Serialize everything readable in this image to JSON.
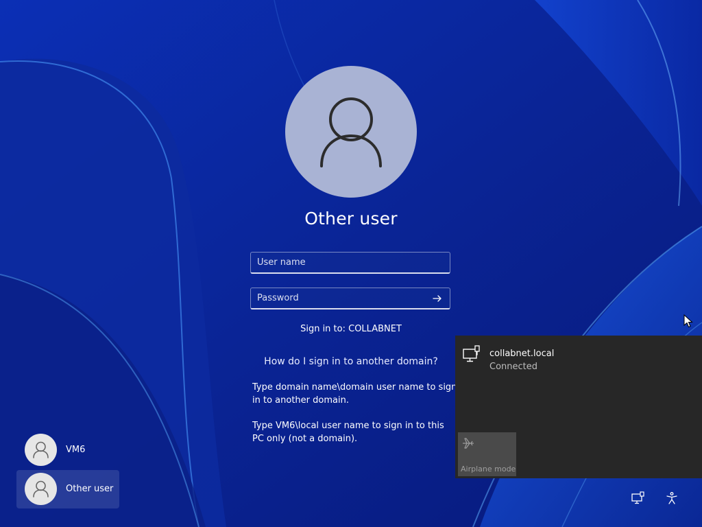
{
  "login": {
    "user_title": "Other user",
    "username_placeholder": "User name",
    "password_placeholder": "Password",
    "sign_in_to": "Sign in to: COLLABNET",
    "help_link": "How do I sign in to another domain?",
    "help_text_1": "Type domain name\\domain user name to sign in to another domain.",
    "help_text_2": "Type VM6\\local user name to sign in to this PC only (not a domain)."
  },
  "users": [
    {
      "name": "VM6",
      "selected": false
    },
    {
      "name": "Other user",
      "selected": true
    }
  ],
  "network_flyout": {
    "network_name": "collabnet.local",
    "status": "Connected",
    "airplane_label": "Airplane mode",
    "airplane_on": false
  },
  "tray": {
    "icons": [
      "network-icon",
      "accessibility-icon"
    ]
  },
  "colors": {
    "background": "#0a2aa0",
    "avatar": "#a9b3d4",
    "flyout": "#272727",
    "airplane_tile": "#4a4a4a"
  }
}
